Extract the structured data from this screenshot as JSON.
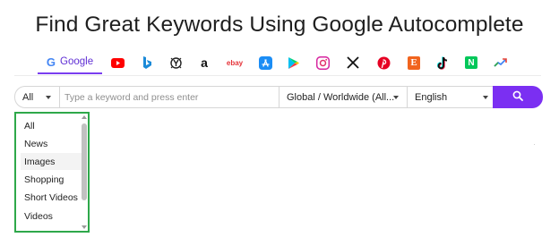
{
  "page": {
    "title": "Find Great Keywords Using Google Autocomplete"
  },
  "engines": {
    "items": [
      {
        "id": "google",
        "label": "Google",
        "icon": "google-icon",
        "active": true
      },
      {
        "id": "youtube",
        "icon": "youtube-icon"
      },
      {
        "id": "bing",
        "icon": "bing-icon"
      },
      {
        "id": "yahoo",
        "icon": "yahoo-icon"
      },
      {
        "id": "amazon",
        "icon": "amazon-icon"
      },
      {
        "id": "ebay",
        "icon": "ebay-icon"
      },
      {
        "id": "app-store",
        "icon": "app-store-icon"
      },
      {
        "id": "google-play",
        "icon": "google-play-icon"
      },
      {
        "id": "instagram",
        "icon": "instagram-icon"
      },
      {
        "id": "x",
        "icon": "x-icon"
      },
      {
        "id": "pinterest",
        "icon": "pinterest-icon"
      },
      {
        "id": "etsy",
        "icon": "etsy-icon"
      },
      {
        "id": "tiktok",
        "icon": "tiktok-icon"
      },
      {
        "id": "naver",
        "icon": "naver-icon"
      },
      {
        "id": "trends",
        "icon": "trends-icon"
      }
    ],
    "ebay_text": "ebay",
    "etsy_text": "E",
    "naver_text": "N",
    "amazon_text": "a",
    "google_g": "G"
  },
  "search": {
    "category_value": "All",
    "placeholder": "Type a keyword and press enter",
    "region_value": "Global / Worldwide (All...",
    "language_value": "English",
    "search_icon": "search-icon"
  },
  "dropdown": {
    "options": [
      "All",
      "News",
      "Images",
      "Shopping",
      "Short Videos",
      "Videos"
    ],
    "highlighted": "Images"
  },
  "colors": {
    "accent": "#7b2ff2",
    "dropdown_border": "#2ea84a"
  }
}
